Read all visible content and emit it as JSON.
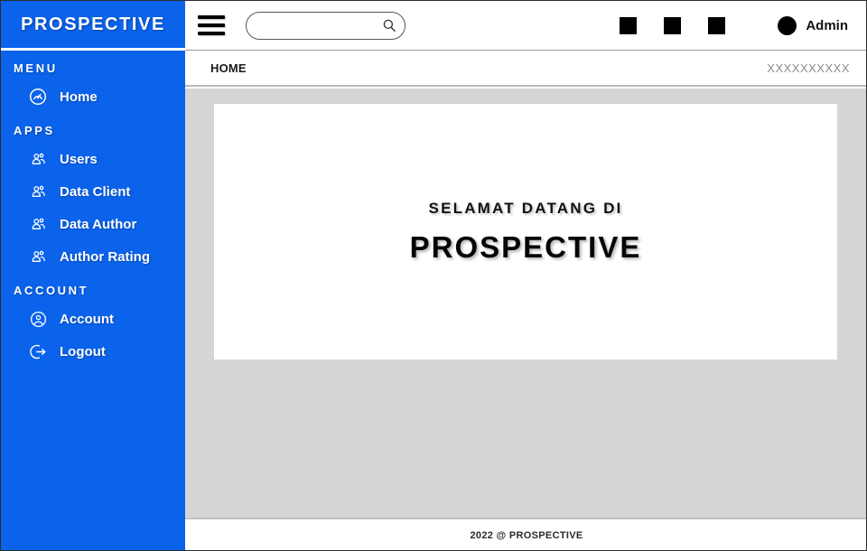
{
  "colors": {
    "sidebar_blue": "#0B63EC",
    "content_gray": "#D5D5D5",
    "card_white": "#FFFFFF",
    "icon_black": "#000000",
    "muted_text": "#8C8C8C"
  },
  "sidebar": {
    "brand": "PROSPECTIVE",
    "sections": [
      {
        "label": "MENU",
        "items": [
          {
            "label": "Home",
            "icon": "speedometer-icon"
          }
        ]
      },
      {
        "label": "APPS",
        "items": [
          {
            "label": "Users",
            "icon": "people-group-icon"
          },
          {
            "label": "Data Client",
            "icon": "people-group-icon"
          },
          {
            "label": "Data Author",
            "icon": "people-group-icon"
          },
          {
            "label": "Author Rating",
            "icon": "people-group-icon"
          }
        ]
      },
      {
        "label": "ACCOUNT",
        "items": [
          {
            "label": "Account",
            "icon": "user-circle-icon"
          },
          {
            "label": "Logout",
            "icon": "logout-arrow-icon"
          }
        ]
      }
    ]
  },
  "topbar": {
    "menu_toggle_icon": "hamburger-icon",
    "search": {
      "value": "",
      "placeholder": "",
      "icon": "search-icon"
    },
    "icons": [
      {
        "name": "placeholder-square-icon-1"
      },
      {
        "name": "placeholder-square-icon-2"
      },
      {
        "name": "placeholder-square-icon-3"
      }
    ],
    "user": {
      "avatar_icon": "avatar-circle-icon",
      "name": "Admin"
    }
  },
  "breadcrumb": {
    "title": "HOME",
    "right": "XXXXXXXXXX"
  },
  "main": {
    "card": {
      "welcome_small": "SELAMAT DATANG DI",
      "welcome_big": "PROSPECTIVE"
    }
  },
  "footer": {
    "text": "2022 @ PROSPECTIVE"
  }
}
